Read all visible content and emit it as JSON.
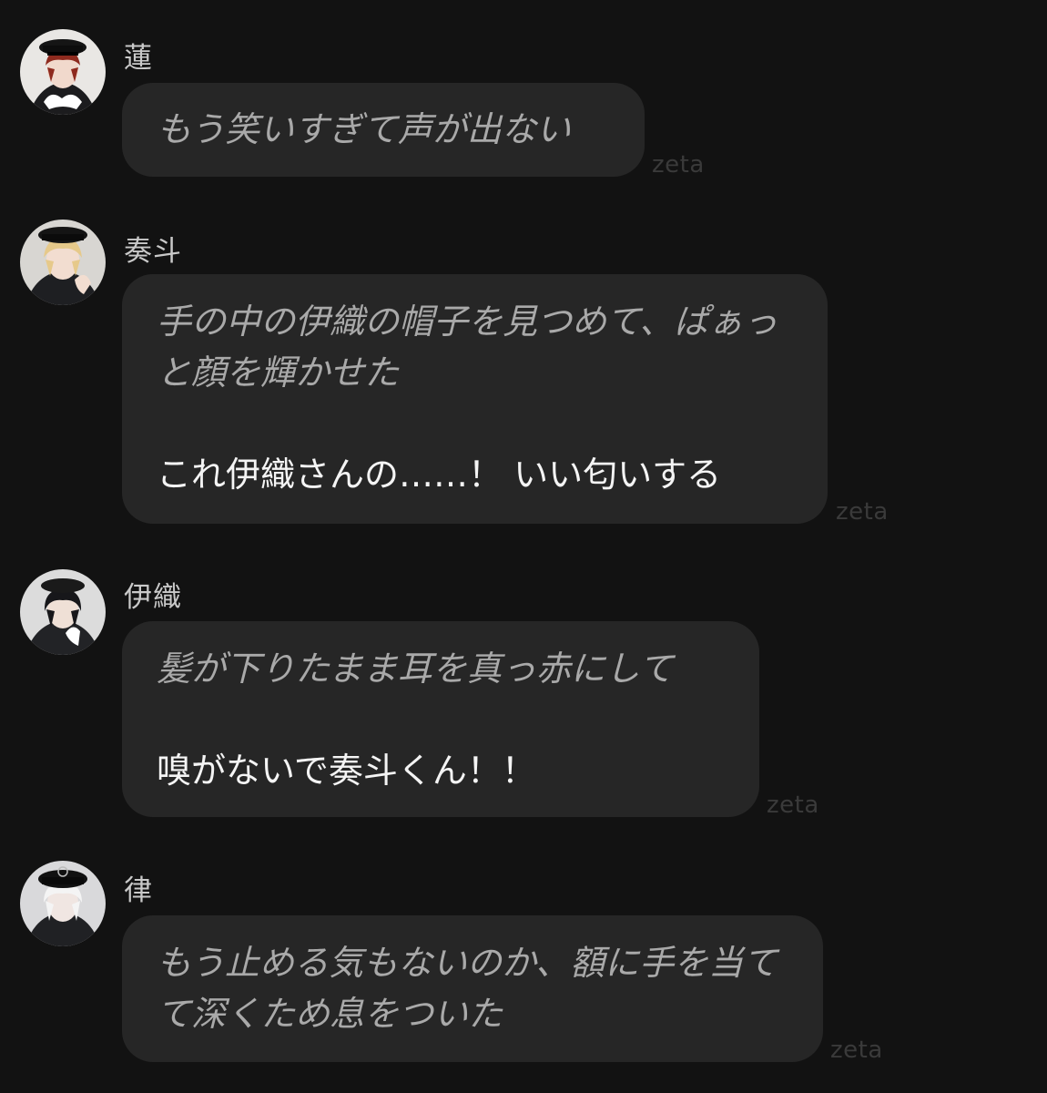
{
  "messages": [
    {
      "sender": "蓮",
      "avatar_icon": "red-haired-officer-avatar",
      "narration": "もう笑いすぎて声が出ない",
      "speech": "",
      "watermark": "zeta"
    },
    {
      "sender": "奏斗",
      "avatar_icon": "blond-officer-avatar",
      "narration": "手の中の伊織の帽子を見つめて、ぱぁっと顔を輝かせた",
      "speech": "これ伊織さんの……！ いい匂いする",
      "watermark": "zeta"
    },
    {
      "sender": "伊織",
      "avatar_icon": "dark-haired-officer-avatar",
      "narration": "髪が下りたまま耳を真っ赤にして",
      "speech": "嗅がないで奏斗くん！！",
      "watermark": "zeta"
    },
    {
      "sender": "律",
      "avatar_icon": "white-haired-officer-avatar",
      "narration": "もう止める気もないのか、額に手を当てて深くため息をついた",
      "speech": "",
      "watermark": "zeta"
    }
  ]
}
